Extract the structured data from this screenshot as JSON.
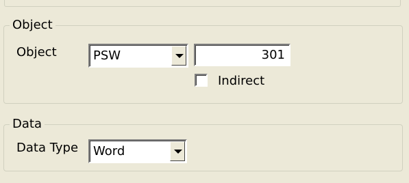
{
  "object_group": {
    "title": "Object",
    "object_label": "Object",
    "object_combo_value": "PSW",
    "address_value": "301",
    "indirect_label": "Indirect",
    "indirect_checked": false
  },
  "data_group": {
    "title": "Data",
    "data_type_label": "Data Type",
    "data_type_value": "Word"
  },
  "icons": {
    "dropdown": "chevron-down-icon"
  }
}
